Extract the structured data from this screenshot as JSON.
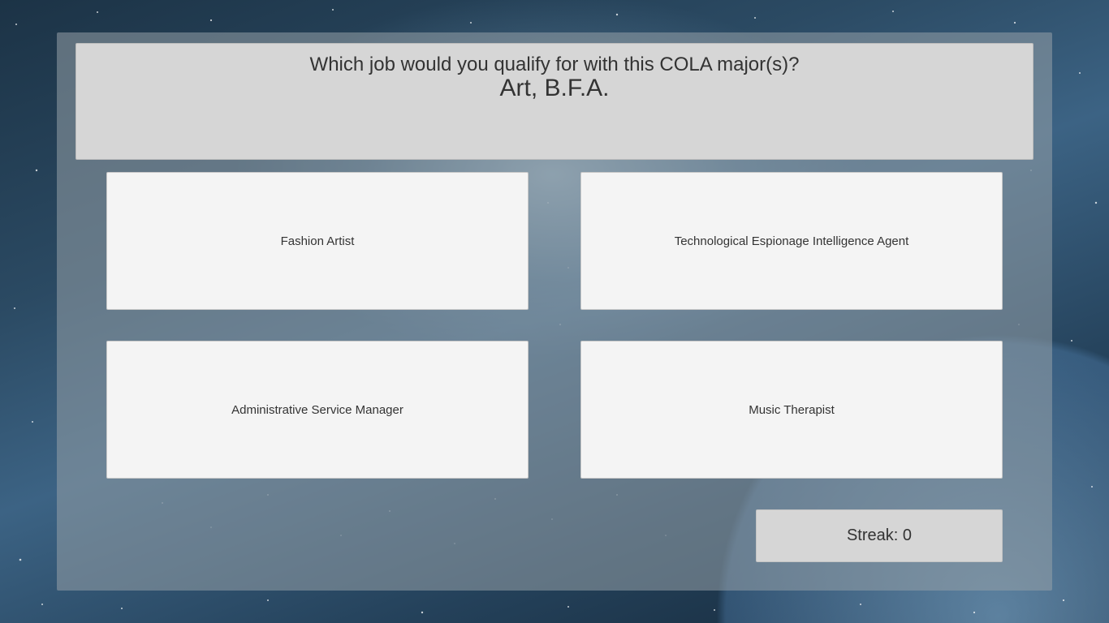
{
  "question": {
    "prompt": "Which job would you qualify for with this COLA major(s)?",
    "major": "Art, B.F.A."
  },
  "answers": [
    "Fashion Artist",
    "Technological Espionage Intelligence Agent",
    "Administrative Service Manager",
    "Music Therapist"
  ],
  "streak": {
    "label": "Streak: 0",
    "value": 0
  },
  "colors": {
    "question_bg": "#d6d6d6",
    "answer_bg": "#f4f4f4",
    "text": "#333333"
  }
}
